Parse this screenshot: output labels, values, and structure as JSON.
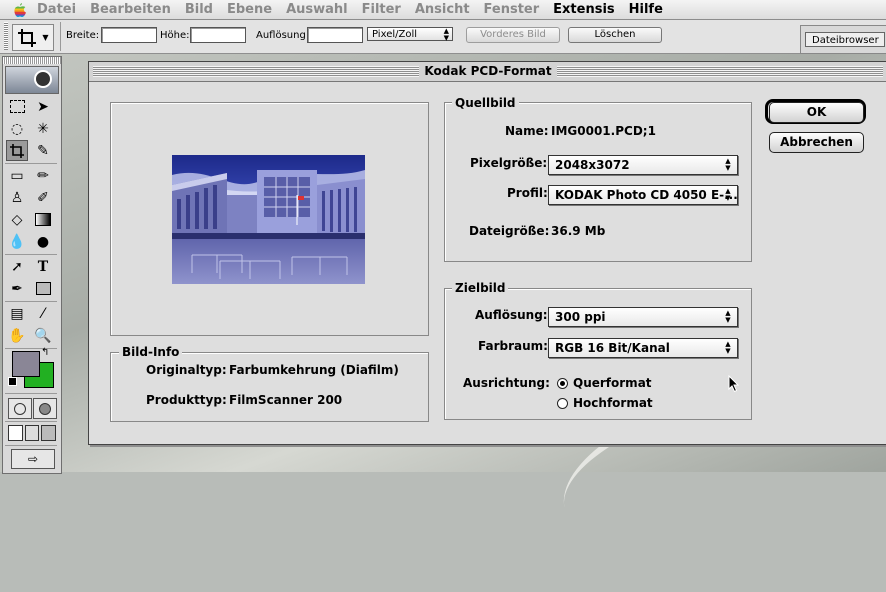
{
  "menubar": {
    "items": [
      "Datei",
      "Bearbeiten",
      "Bild",
      "Ebene",
      "Auswahl",
      "Filter",
      "Ansicht",
      "Fenster",
      "Extensis",
      "Hilfe"
    ],
    "active": [
      "Extensis",
      "Hilfe"
    ]
  },
  "options": {
    "breite_label": "Breite:",
    "hoehe_label": "Höhe:",
    "aufloesung_label": "Auflösung:",
    "unit_value": "Pixel/Zoll",
    "vorderes_bild": "Vorderes Bild",
    "loeschen": "Löschen",
    "palette_tab": "Dateibrowser"
  },
  "dialog": {
    "title": "Kodak PCD-Format",
    "ok": "OK",
    "cancel": "Abbrechen",
    "bildinfo": {
      "legend": "Bild-Info",
      "originaltyp_label": "Originaltyp:",
      "originaltyp_value": "Farbumkehrung (Diafilm)",
      "produkttyp_label": "Produkttyp:",
      "produkttyp_value": "FilmScanner 200"
    },
    "quellbild": {
      "legend": "Quellbild",
      "name_label": "Name:",
      "name_value": "IMG0001.PCD;1",
      "pixel_label": "Pixelgröße:",
      "pixel_value": "2048x3072",
      "profil_label": "Profil:",
      "profil_value": "KODAK Photo CD 4050 E-...",
      "dateigroesse_label": "Dateigröße:",
      "dateigroesse_value": "36.9 Mb"
    },
    "zielbild": {
      "legend": "Zielbild",
      "aufloesung_label": "Auflösung:",
      "aufloesung_value": "300 ppi",
      "farbraum_label": "Farbraum:",
      "farbraum_value": "RGB 16 Bit/Kanal",
      "ausrichtung_label": "Ausrichtung:",
      "querformat": "Querformat",
      "hochformat": "Hochformat",
      "selected": "Querformat"
    }
  },
  "colors": {
    "foreground_swatch": "#8a8696",
    "background_swatch": "#22b022"
  }
}
